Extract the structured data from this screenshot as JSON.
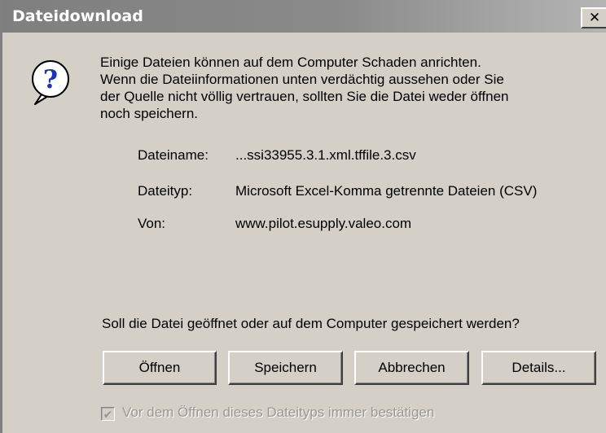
{
  "window": {
    "title": "Dateidownload",
    "close_glyph": "✕",
    "title_gradient": [
      "#7f7f7f",
      "#b5b5b5"
    ],
    "background": "#d4d0c8"
  },
  "icon": {
    "name": "question-icon",
    "glyph": "?"
  },
  "message": {
    "lines": [
      "Einige Dateien können auf dem Computer Schaden anrichten.",
      "Wenn die Dateiinformationen unten verdächtig aussehen oder Sie",
      "der Quelle nicht völlig vertrauen, sollten Sie die Datei weder öffnen",
      "noch speichern."
    ]
  },
  "file_info": {
    "filename_label": "Dateiname:",
    "filename_value": "...ssi33955.3.1.xml.tffile.3.csv",
    "filetype_label": "Dateityp:",
    "filetype_value": "Microsoft Excel-Komma getrennte Dateien (CSV)",
    "from_label": "Von:",
    "from_value": "www.pilot.esupply.valeo.com"
  },
  "question": "Soll die Datei geöffnet oder auf dem Computer gespeichert werden?",
  "buttons": {
    "open": "Öffnen",
    "save": "Speichern",
    "cancel": "Abbrechen",
    "details": "Details..."
  },
  "checkbox": {
    "label": "Vor dem Öffnen dieses Dateityps immer bestätigen",
    "checked": true,
    "enabled": false,
    "check_glyph": "✔"
  }
}
